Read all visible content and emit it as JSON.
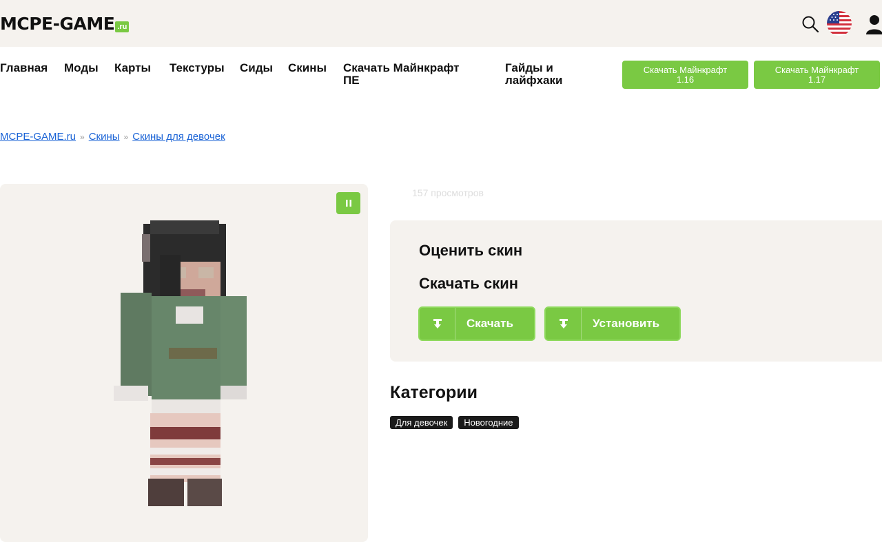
{
  "header": {
    "logo_main": "MCPE-GAME",
    "logo_suffix": ".ru"
  },
  "nav": {
    "items": [
      "Главная",
      "Моды",
      "Карты",
      "Текстуры",
      "Сиды",
      "Скины"
    ],
    "download_pe_line1": "Скачать Майнкрафт",
    "download_pe_line2": "ПЕ",
    "guides_line1": "Гайды и",
    "guides_line2": "лайфхаки",
    "btn1_line1": "Скачать Майнкрафт",
    "btn1_line2": "1.16",
    "btn2_line1": "Скачать Майнкрафт",
    "btn2_line2": "1.17"
  },
  "breadcrumb": {
    "home": "MCPE-GAME.ru",
    "sep": "»",
    "skins": "Скины",
    "girls": "Скины для девочек"
  },
  "skin": {
    "views": "157 просмотров"
  },
  "rate": {
    "title": "Оценить скин",
    "download_title": "Скачать скин",
    "download_btn": "Скачать",
    "install_btn": "Установить"
  },
  "categories": {
    "title": "Категории",
    "tags": [
      "Для девочек",
      "Новогодние"
    ]
  },
  "colors": {
    "accent": "#7ac943",
    "panel_bg": "#f5f2ee",
    "link": "#1a63d6"
  }
}
